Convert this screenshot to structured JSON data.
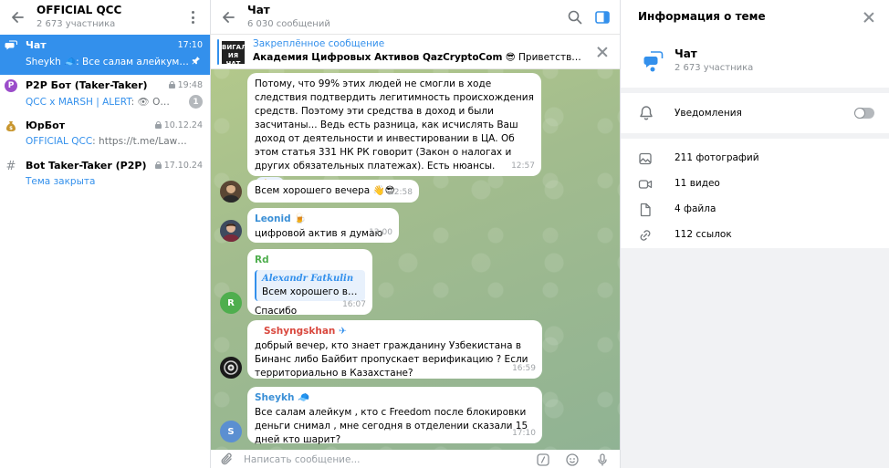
{
  "left": {
    "title": "OFFICIAL QCC",
    "subtitle": "2 673 участника",
    "topics": [
      {
        "name": "Чат",
        "time": "17:10",
        "sender": "Sheykh",
        "sender_emoji": "🧢",
        "text": ": Все салам алейкум , кто ..."
      },
      {
        "name": "P2P Бот (Taker-Taker)",
        "time": "19:48",
        "sender": "QCC x MARSH | ALERT",
        "text": ": 👁 Обнаруж...",
        "badge": "1"
      },
      {
        "name": "ЮрБот",
        "time": "10.12.24",
        "sender": "OFFICIAL QCC",
        "text": ": https://t.me/LawyerCrypt..."
      },
      {
        "name": "Bot Taker-Taker (P2P)",
        "time": "17.10.24",
        "sender": "Тема закрыта",
        "text": ""
      }
    ]
  },
  "chat": {
    "title": "Чат",
    "subtitle": "6 030 сообщений",
    "pinned": {
      "label": "Закреплённое сообщение",
      "thumb_text": "ВИГАЛ ИЯ ЧАТ ВИ",
      "bold_text": "Академия Цифровых Активов QazCryptoCom",
      "rest_text": " 😎 Приветствуем вас в на..."
    },
    "messages": {
      "m1": {
        "text": "Потому, что 99% этих людей не смогли в ходе следствия подтвердить легитимность происхождения средств. Поэтому эти средства в доход и были засчитаны... Ведь есть разница, как исчислять Ваш доход от деятельности и инвестировании в ЦА. Об этом статья 331 НК РК говорит (Закон о налогах и других обязательных платежах). Есть нюансы.",
        "reaction": "👍",
        "time": "12:57"
      },
      "m2": {
        "text": "Всем хорошего вечера 👋😎",
        "time": "12:58"
      },
      "m3": {
        "author": "Leonid",
        "author_emoji": "🍺",
        "text": "цифровой актив я думаю",
        "time": "13:00"
      },
      "m4": {
        "author": "Rd",
        "quote_name": "Alexandr Fatkulin",
        "quote_text": "Всем хорошего вече...",
        "text": "Спасибо",
        "time": "16:07",
        "avatar_letter": "R"
      },
      "m5": {
        "author": "Sshyngskhan",
        "author_emoji": "✈",
        "text": "добрый вечер, кто знает гражданину Узбекистана в Бинанс либо Байбит пропускает верификацию ? Если территориально в Казахстане?",
        "time": "16:59"
      },
      "m6": {
        "author": "Sheykh",
        "author_emoji": "🧢",
        "text": "Все салам алейкум , кто с Freedom после блокировки деньги снимал , мне сегодня в отделении сказали 15 дней кто шарит?",
        "time": "17:10",
        "avatar_letter": "S"
      }
    },
    "composer": {
      "placeholder": "Написать сообщение..."
    }
  },
  "right": {
    "title": "Информация о теме",
    "topic_name": "Чат",
    "topic_sub": "2 673 участника",
    "notifications_label": "Уведомления",
    "notifications_on": false,
    "media": [
      {
        "label": "211 фотографий",
        "icon": "photo-icon"
      },
      {
        "label": "11 видео",
        "icon": "video-icon"
      },
      {
        "label": "4 файла",
        "icon": "file-icon"
      },
      {
        "label": "112 ссылок",
        "icon": "link-icon"
      }
    ]
  },
  "colors": {
    "accent": "#3390ec",
    "author_leonid": "#3a8fd6",
    "author_rd": "#4fae4e",
    "author_sshyngskhan": "#d9483e",
    "author_sheykh": "#3a8fd6"
  }
}
